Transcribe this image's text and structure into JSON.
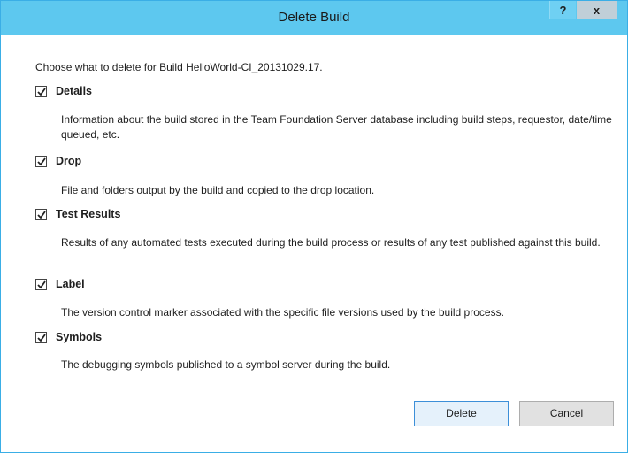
{
  "window": {
    "title": "Delete Build",
    "help_label": "?",
    "close_label": "x"
  },
  "intro": "Choose what to delete for Build HelloWorld-CI_20131029.17.",
  "options": [
    {
      "label": "Details",
      "checked": true,
      "description": "Information about the build stored in the Team Foundation Server database including build steps, requestor, date/time queued, etc."
    },
    {
      "label": "Drop",
      "checked": true,
      "description": "File and folders output by the  build and copied to the drop location."
    },
    {
      "label": "Test Results",
      "checked": true,
      "description": "Results of any automated tests executed during the build process or results of any test published against this build."
    },
    {
      "label": "Label",
      "checked": true,
      "description": "The version control marker associated with the specific file versions used by the build process."
    },
    {
      "label": "Symbols",
      "checked": true,
      "description": "The debugging symbols published to a symbol server during the build."
    }
  ],
  "buttons": {
    "delete": "Delete",
    "cancel": "Cancel"
  },
  "colors": {
    "titlebar": "#5dc8ef",
    "border": "#3aaee6",
    "default_button_border": "#3c8fd8"
  }
}
